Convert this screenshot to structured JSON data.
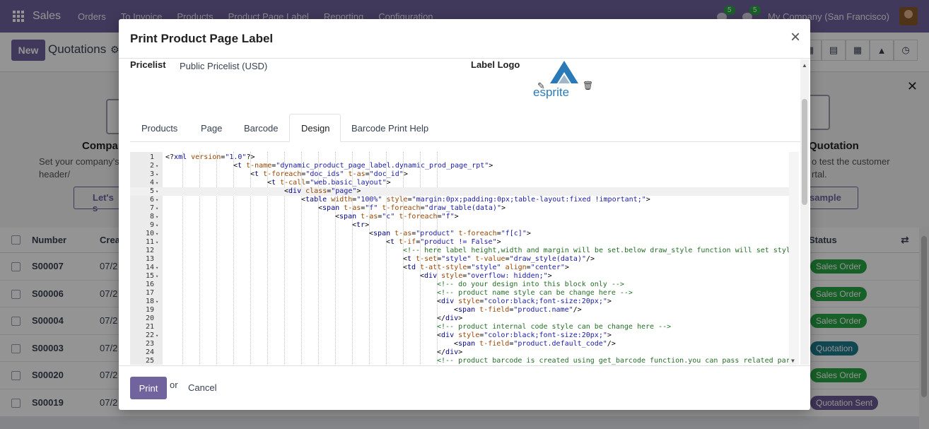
{
  "navbar": {
    "app_name": "Sales",
    "menu": [
      "Orders",
      "To Invoice",
      "Products",
      "Product Page Label",
      "Reporting",
      "Configuration"
    ],
    "chat_count": "5",
    "activity_count": "5",
    "company": "My Company (San Francisco)"
  },
  "control_panel": {
    "new_label": "New",
    "breadcrumb": "Quotations"
  },
  "helper": {
    "left_title": "Compan",
    "left_sub": "Set your company's d header/",
    "left_btn": "Let's s",
    "right_title": "Quotation",
    "right_sub": "o test the customer rtal.",
    "right_btn": "sample"
  },
  "list": {
    "headers": {
      "number": "Number",
      "creation": "Crea",
      "status": "Status"
    },
    "rows": [
      {
        "number": "S00007",
        "date": "07/2",
        "status": "Sales Order",
        "status_color": "#28a745"
      },
      {
        "number": "S00006",
        "date": "07/2",
        "status": "Sales Order",
        "status_color": "#28a745"
      },
      {
        "number": "S00004",
        "date": "07/2",
        "status": "Sales Order",
        "status_color": "#28a745"
      },
      {
        "number": "S00003",
        "date": "07/2",
        "status": "Quotation",
        "status_color": "#1d7a8c"
      },
      {
        "number": "S00020",
        "date": "07/2",
        "status": "Sales Order",
        "status_color": "#28a745"
      },
      {
        "number": "S00019",
        "date": "07/2",
        "status": "Quotation Sent",
        "status_color": "#6b5b95"
      }
    ]
  },
  "modal": {
    "title": "Print Product Page Label",
    "close_symbol": "×",
    "pricelist_label": "Pricelist",
    "pricelist_value": "Public Pricelist (USD)",
    "label_logo_label": "Label Logo",
    "logo_text": "esprite",
    "tabs": [
      "Products",
      "Page",
      "Barcode",
      "Design",
      "Barcode Print Help"
    ],
    "active_tab": "Design",
    "print_label": "Print",
    "or_text": "or",
    "cancel_label": "Cancel"
  },
  "code_lines": [
    {
      "n": "1",
      "fold": false,
      "indent": 0,
      "html": "&lt;?<span class='c-tag'>xml</span> <span class='c-attr'>version</span>=<span class='c-val'>\"1.0\"</span>?&gt;"
    },
    {
      "n": "2",
      "fold": true,
      "indent": 4,
      "html": "&lt;<span class='c-tag'>t</span> <span class='c-attr'>t-name</span>=<span class='c-val'>\"dynamic_product_page_label.dynamic_prod_page_rpt\"</span>&gt;"
    },
    {
      "n": "3",
      "fold": true,
      "indent": 5,
      "html": "&lt;<span class='c-tag'>t</span> <span class='c-attr'>t-foreach</span>=<span class='c-val'>\"doc_ids\"</span> <span class='c-attr'>t-as</span>=<span class='c-val'>\"doc_id\"</span>&gt;"
    },
    {
      "n": "4",
      "fold": true,
      "indent": 6,
      "html": "&lt;<span class='c-tag'>t</span> <span class='c-attr'>t-call</span>=<span class='c-val'>\"web.basic_layout\"</span>&gt;"
    },
    {
      "n": "5",
      "fold": true,
      "indent": 7,
      "html": "&lt;<span class='c-tag'>div</span> <span class='c-attr'>class</span>=<span class='c-val'>\"page\"</span>&gt;",
      "active": true
    },
    {
      "n": "6",
      "fold": true,
      "indent": 8,
      "html": "&lt;<span class='c-tag'>table</span> <span class='c-attr'>width</span>=<span class='c-val'>\"100%\"</span> <span class='c-attr'>style</span>=<span class='c-val'>\"margin:0px;padding:0px;table-layout:fixed !important;\"</span>&gt;"
    },
    {
      "n": "7",
      "fold": true,
      "indent": 9,
      "html": "&lt;<span class='c-tag'>span</span> <span class='c-attr'>t-as</span>=<span class='c-val'>\"f\"</span> <span class='c-attr'>t-foreach</span>=<span class='c-val'>\"draw_table(data)\"</span>&gt;"
    },
    {
      "n": "8",
      "fold": true,
      "indent": 10,
      "html": "&lt;<span class='c-tag'>span</span> <span class='c-attr'>t-as</span>=<span class='c-val'>\"c\"</span> <span class='c-attr'>t-foreach</span>=<span class='c-val'>\"f\"</span>&gt;"
    },
    {
      "n": "9",
      "fold": true,
      "indent": 11,
      "html": "&lt;<span class='c-tag'>tr</span>&gt;"
    },
    {
      "n": "10",
      "fold": true,
      "indent": 12,
      "html": "&lt;<span class='c-tag'>span</span> <span class='c-attr'>t-as</span>=<span class='c-val'>\"product\"</span> <span class='c-attr'>t-foreach</span>=<span class='c-val'>\"f[c]\"</span>&gt;"
    },
    {
      "n": "11",
      "fold": true,
      "indent": 13,
      "html": "&lt;<span class='c-tag'>t</span> <span class='c-attr'>t-if</span>=<span class='c-val'>\"product != False\"</span>&gt;"
    },
    {
      "n": "12",
      "fold": false,
      "indent": 14,
      "html": "<span class='c-com'>&lt;!-- here label height,width and margin will be set.below draw_style function will set styl</span>"
    },
    {
      "n": "13",
      "fold": false,
      "indent": 14,
      "html": "&lt;<span class='c-tag'>t</span> <span class='c-attr'>t-set</span>=<span class='c-val'>\"style\"</span> <span class='c-attr'>t-value</span>=<span class='c-val'>\"draw_style(data)\"</span>/&gt;"
    },
    {
      "n": "14",
      "fold": true,
      "indent": 14,
      "html": "&lt;<span class='c-tag'>td</span> <span class='c-attr'>t-att-style</span>=<span class='c-val'>\"style\"</span> <span class='c-attr'>align</span>=<span class='c-val'>\"center\"</span>&gt;"
    },
    {
      "n": "15",
      "fold": true,
      "indent": 15,
      "html": "&lt;<span class='c-tag'>div</span> <span class='c-attr'>style</span>=<span class='c-val'>\"overflow: hidden;\"</span>&gt;"
    },
    {
      "n": "16",
      "fold": false,
      "indent": 16,
      "html": "<span class='c-com'>&lt;!-- do your design into this block only --&gt;</span>"
    },
    {
      "n": "17",
      "fold": false,
      "indent": 16,
      "html": "<span class='c-com'>&lt;!-- product name style can be change here --&gt;</span>"
    },
    {
      "n": "18",
      "fold": true,
      "indent": 16,
      "html": "&lt;<span class='c-tag'>div</span> <span class='c-attr'>style</span>=<span class='c-val'>\"color:black;font-size:20px;\"</span>&gt;"
    },
    {
      "n": "19",
      "fold": false,
      "indent": 17,
      "html": "&lt;<span class='c-tag'>span</span> <span class='c-attr'>t-field</span>=<span class='c-val'>\"product.name\"</span>/&gt;"
    },
    {
      "n": "20",
      "fold": false,
      "indent": 16,
      "html": "&lt;/<span class='c-tag'>div</span>&gt;"
    },
    {
      "n": "21",
      "fold": false,
      "indent": 16,
      "html": "<span class='c-com'>&lt;!-- product internal code style can be change here --&gt;</span>"
    },
    {
      "n": "22",
      "fold": true,
      "indent": 16,
      "html": "&lt;<span class='c-tag'>div</span> <span class='c-attr'>style</span>=<span class='c-val'>\"color:black;font-size:20px;\"</span>&gt;"
    },
    {
      "n": "23",
      "fold": false,
      "indent": 17,
      "html": "&lt;<span class='c-tag'>span</span> <span class='c-attr'>t-field</span>=<span class='c-val'>\"product.default_code\"</span>/&gt;"
    },
    {
      "n": "24",
      "fold": false,
      "indent": 16,
      "html": "&lt;/<span class='c-tag'>div</span>&gt;"
    },
    {
      "n": "25",
      "fold": false,
      "indent": 16,
      "html": "<span class='c-com'>&lt;!-- product barcode is created using get_barcode function.you can pass related par</span>"
    }
  ],
  "colors": {
    "brand": "#71639e",
    "status_green": "#28a745",
    "status_teal": "#1d7a8c",
    "status_purple": "#6b5b95"
  }
}
